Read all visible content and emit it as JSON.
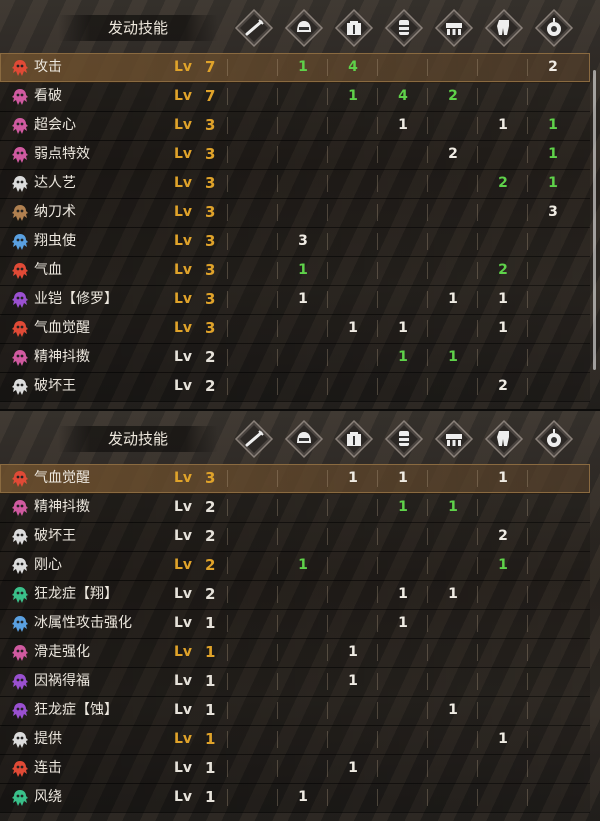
{
  "header": {
    "title": "发动技能",
    "equipment_icons": [
      "weapon-icon",
      "helm-icon",
      "chest-icon",
      "arms-icon",
      "waist-icon",
      "legs-icon",
      "talisman-icon"
    ]
  },
  "colors": {
    "level_highlight": "#e0a32a",
    "green_value": "#5fd24a",
    "white_value": "#f0ece4"
  },
  "lv_label": "Lv",
  "panel1": {
    "rows": [
      {
        "name": "攻击",
        "icon": "skill-icon",
        "icon_color": "#e04a36",
        "level": "7",
        "gold": true,
        "highlight": true,
        "cells": [
          {
            "col": 1,
            "v": "1",
            "c": "g"
          },
          {
            "col": 2,
            "v": "4",
            "c": "g"
          },
          {
            "col": 6,
            "v": "2",
            "c": "w"
          }
        ]
      },
      {
        "name": "看破",
        "icon": "skill-icon",
        "icon_color": "#d05aa0",
        "level": "7",
        "gold": true,
        "cells": [
          {
            "col": 2,
            "v": "1",
            "c": "g"
          },
          {
            "col": 3,
            "v": "4",
            "c": "g"
          },
          {
            "col": 4,
            "v": "2",
            "c": "g"
          }
        ]
      },
      {
        "name": "超会心",
        "icon": "skill-icon",
        "icon_color": "#d05aa0",
        "level": "3",
        "gold": true,
        "cells": [
          {
            "col": 3,
            "v": "1",
            "c": "w"
          },
          {
            "col": 5,
            "v": "1",
            "c": "w"
          },
          {
            "col": 6,
            "v": "1",
            "c": "g"
          }
        ]
      },
      {
        "name": "弱点特效",
        "icon": "skill-icon",
        "icon_color": "#d05aa0",
        "level": "3",
        "gold": true,
        "cells": [
          {
            "col": 4,
            "v": "2",
            "c": "w"
          },
          {
            "col": 6,
            "v": "1",
            "c": "g"
          }
        ]
      },
      {
        "name": "达人艺",
        "icon": "skill-icon",
        "icon_color": "#dcdcdc",
        "level": "3",
        "gold": true,
        "cells": [
          {
            "col": 5,
            "v": "2",
            "c": "g"
          },
          {
            "col": 6,
            "v": "1",
            "c": "g"
          }
        ]
      },
      {
        "name": "纳刀术",
        "icon": "skill-icon",
        "icon_color": "#b08050",
        "level": "3",
        "gold": true,
        "cells": [
          {
            "col": 6,
            "v": "3",
            "c": "w"
          }
        ]
      },
      {
        "name": "翔虫使",
        "icon": "skill-icon",
        "icon_color": "#5aa0e0",
        "level": "3",
        "gold": true,
        "cells": [
          {
            "col": 1,
            "v": "3",
            "c": "w"
          }
        ]
      },
      {
        "name": "气血",
        "icon": "skill-icon",
        "icon_color": "#e04a36",
        "level": "3",
        "gold": true,
        "cells": [
          {
            "col": 1,
            "v": "1",
            "c": "g"
          },
          {
            "col": 5,
            "v": "2",
            "c": "g"
          }
        ]
      },
      {
        "name": "业铠【修罗】",
        "icon": "skill-icon",
        "icon_color": "#9a50d0",
        "level": "3",
        "gold": true,
        "cells": [
          {
            "col": 1,
            "v": "1",
            "c": "w"
          },
          {
            "col": 4,
            "v": "1",
            "c": "w"
          },
          {
            "col": 5,
            "v": "1",
            "c": "w"
          }
        ]
      },
      {
        "name": "气血觉醒",
        "icon": "skill-icon",
        "icon_color": "#e04a36",
        "level": "3",
        "gold": true,
        "cells": [
          {
            "col": 2,
            "v": "1",
            "c": "w"
          },
          {
            "col": 3,
            "v": "1",
            "c": "w"
          },
          {
            "col": 5,
            "v": "1",
            "c": "w"
          }
        ]
      },
      {
        "name": "精神抖擞",
        "icon": "skill-icon",
        "icon_color": "#d05aa0",
        "level": "2",
        "gold": false,
        "cells": [
          {
            "col": 3,
            "v": "1",
            "c": "g"
          },
          {
            "col": 4,
            "v": "1",
            "c": "g"
          }
        ]
      },
      {
        "name": "破坏王",
        "icon": "skill-icon",
        "icon_color": "#dcdcdc",
        "level": "2",
        "gold": false,
        "cells": [
          {
            "col": 5,
            "v": "2",
            "c": "w"
          }
        ]
      }
    ]
  },
  "panel2": {
    "rows": [
      {
        "name": "气血觉醒",
        "icon": "skill-icon",
        "icon_color": "#e04a36",
        "level": "3",
        "gold": true,
        "highlight": true,
        "cells": [
          {
            "col": 2,
            "v": "1",
            "c": "w"
          },
          {
            "col": 3,
            "v": "1",
            "c": "w"
          },
          {
            "col": 5,
            "v": "1",
            "c": "w"
          }
        ]
      },
      {
        "name": "精神抖擞",
        "icon": "skill-icon",
        "icon_color": "#d05aa0",
        "level": "2",
        "gold": false,
        "cells": [
          {
            "col": 3,
            "v": "1",
            "c": "g"
          },
          {
            "col": 4,
            "v": "1",
            "c": "g"
          }
        ]
      },
      {
        "name": "破坏王",
        "icon": "skill-icon",
        "icon_color": "#dcdcdc",
        "level": "2",
        "gold": false,
        "cells": [
          {
            "col": 5,
            "v": "2",
            "c": "w"
          }
        ]
      },
      {
        "name": "刚心",
        "icon": "skill-icon",
        "icon_color": "#dcdcdc",
        "level": "2",
        "gold": true,
        "cells": [
          {
            "col": 1,
            "v": "1",
            "c": "g"
          },
          {
            "col": 5,
            "v": "1",
            "c": "g"
          }
        ]
      },
      {
        "name": "狂龙症【翔】",
        "icon": "skill-icon",
        "icon_color": "#3ac08a",
        "level": "2",
        "gold": false,
        "cells": [
          {
            "col": 3,
            "v": "1",
            "c": "w"
          },
          {
            "col": 4,
            "v": "1",
            "c": "w"
          }
        ]
      },
      {
        "name": "冰属性攻击强化",
        "icon": "skill-icon",
        "icon_color": "#5aa0e0",
        "level": "1",
        "gold": false,
        "cells": [
          {
            "col": 3,
            "v": "1",
            "c": "w"
          }
        ]
      },
      {
        "name": "滑走强化",
        "icon": "skill-icon",
        "icon_color": "#d05aa0",
        "level": "1",
        "gold": true,
        "cells": [
          {
            "col": 2,
            "v": "1",
            "c": "w"
          }
        ]
      },
      {
        "name": "因祸得福",
        "icon": "skill-icon",
        "icon_color": "#9a50d0",
        "level": "1",
        "gold": false,
        "cells": [
          {
            "col": 2,
            "v": "1",
            "c": "w"
          }
        ]
      },
      {
        "name": "狂龙症【蚀】",
        "icon": "skill-icon",
        "icon_color": "#9a50d0",
        "level": "1",
        "gold": false,
        "cells": [
          {
            "col": 4,
            "v": "1",
            "c": "w"
          }
        ]
      },
      {
        "name": "提供",
        "icon": "skill-icon",
        "icon_color": "#dcdcdc",
        "level": "1",
        "gold": true,
        "cells": [
          {
            "col": 5,
            "v": "1",
            "c": "w"
          }
        ]
      },
      {
        "name": "连击",
        "icon": "skill-icon",
        "icon_color": "#e04a36",
        "level": "1",
        "gold": false,
        "cells": [
          {
            "col": 2,
            "v": "1",
            "c": "w"
          }
        ]
      },
      {
        "name": "风绕",
        "icon": "skill-icon",
        "icon_color": "#3ac08a",
        "level": "1",
        "gold": false,
        "cells": [
          {
            "col": 1,
            "v": "1",
            "c": "w"
          }
        ]
      }
    ]
  }
}
